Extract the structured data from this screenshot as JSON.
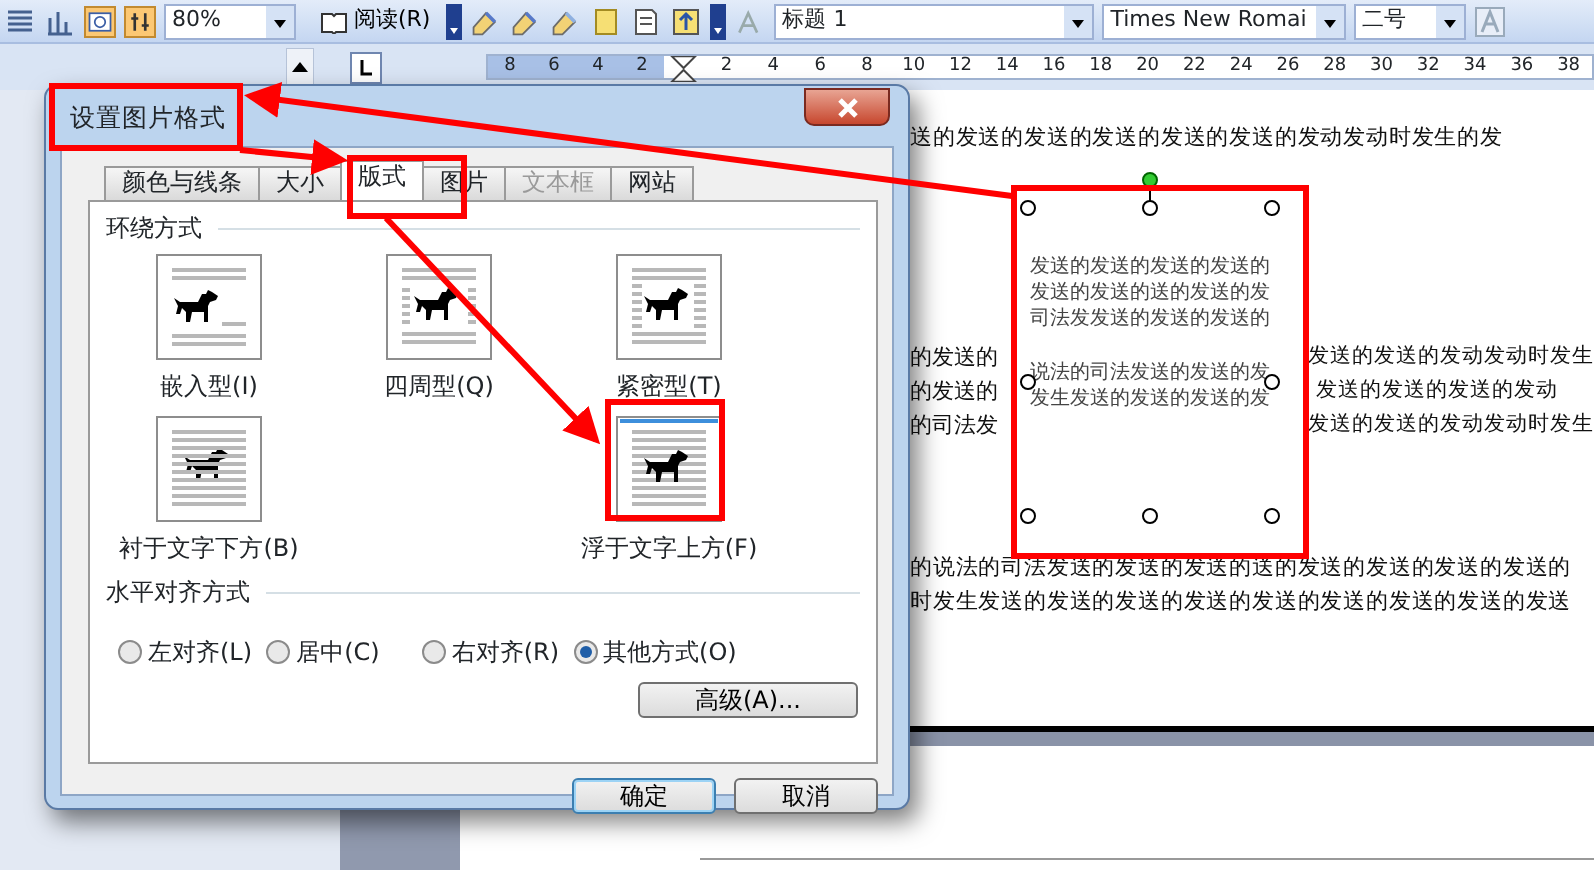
{
  "toolbar": {
    "zoom": "80%",
    "read_button": "阅读(R)",
    "style": "标题 1",
    "font": "Times New Romai",
    "size": "二号"
  },
  "ruler": {
    "left_ticks": [
      "8",
      "6",
      "4",
      "2"
    ],
    "right_ticks": [
      "2",
      "4",
      "6",
      "8",
      "10",
      "12",
      "14",
      "16",
      "18",
      "20",
      "22",
      "24",
      "26",
      "28",
      "30",
      "32",
      "34",
      "36",
      "38"
    ]
  },
  "document": {
    "lines": [
      {
        "segments": [
          "送的发送的发送的发送的发送的发送的发动发动时发生的发"
        ]
      },
      {
        "segments": [
          "的发送的",
          "发送的发送的发动发动时发生"
        ]
      },
      {
        "segments": [
          "的发送的",
          "发送的发送的发送的发动"
        ]
      },
      {
        "segments": [
          "的司法发",
          "发送的发送的发动发动时发生"
        ]
      },
      {
        "segments": [
          "的说法的司法发送的发送的发送的送的发送的发送的发送的发送的"
        ]
      },
      {
        "segments": [
          "时发生发送的发送的发送的发送的发送的发送的发送的发送的发送"
        ]
      }
    ]
  },
  "picture_text": [
    "发送的发送的发送的发送的",
    "发送的发送的送的发送的发",
    "司法发发送的发送的发送的",
    "说法的司法发送的发送的发",
    "发生发送的发送的发送的发"
  ],
  "dialog": {
    "title": "设置图片格式",
    "tabs": [
      {
        "label": "颜色与线条",
        "selected": false,
        "disabled": false
      },
      {
        "label": "大小",
        "selected": false,
        "disabled": false
      },
      {
        "label": "版式",
        "selected": true,
        "disabled": false
      },
      {
        "label": "图片",
        "selected": false,
        "disabled": false
      },
      {
        "label": "文本框",
        "selected": false,
        "disabled": true
      },
      {
        "label": "网站",
        "selected": false,
        "disabled": false
      }
    ],
    "wrap_group": "环绕方式",
    "wrap_styles": [
      {
        "kind": "inline",
        "label": "嵌入型(I)",
        "selected": false
      },
      {
        "kind": "square",
        "label": "四周型(Q)",
        "selected": false
      },
      {
        "kind": "tight",
        "label": "紧密型(T)",
        "selected": false
      },
      {
        "kind": "behind",
        "label": "衬于文字下方(B)",
        "selected": false
      },
      {
        "kind": "front",
        "label": "浮于文字上方(F)",
        "selected": true
      }
    ],
    "align_group": "水平对齐方式",
    "align_options": [
      {
        "label": "左对齐(L)",
        "selected": false
      },
      {
        "label": "居中(C)",
        "selected": false
      },
      {
        "label": "右对齐(R)",
        "selected": false
      },
      {
        "label": "其他方式(O)",
        "selected": true
      }
    ],
    "advanced_button": "高级(A)...",
    "ok_button": "确定",
    "cancel_button": "取消"
  }
}
